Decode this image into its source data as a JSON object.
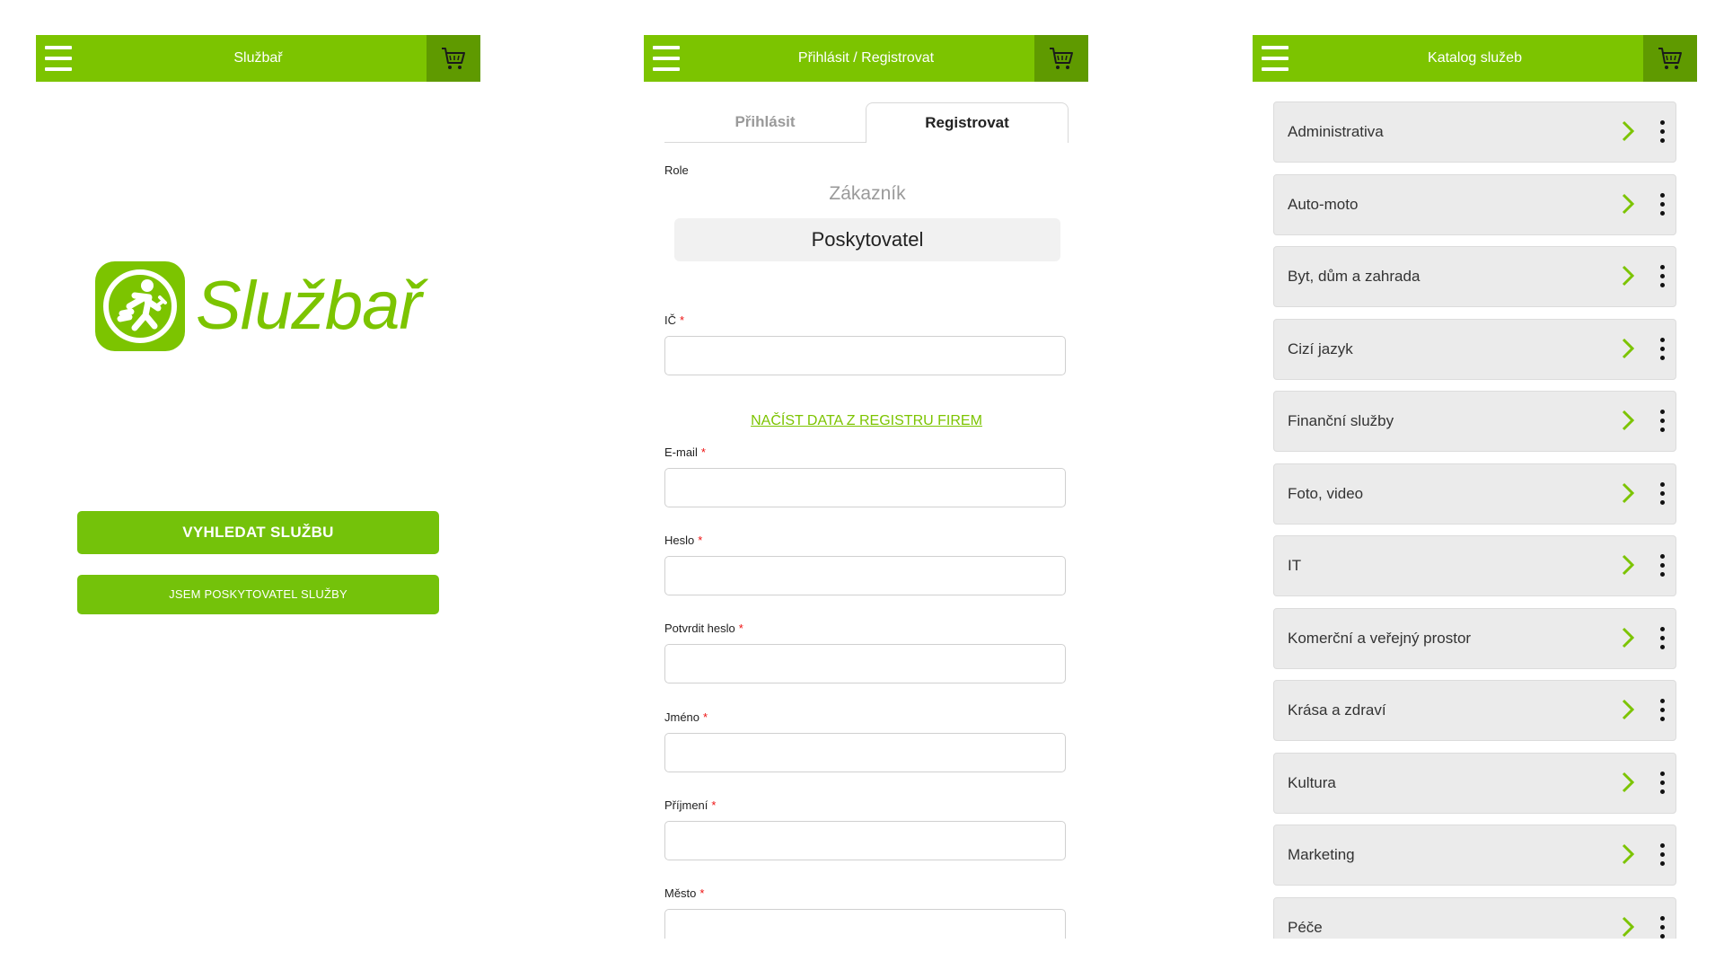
{
  "colors": {
    "accent": "#7cc400",
    "accent_dark": "#5f9a00",
    "required": "#e11111"
  },
  "screen_home": {
    "title": "Službař",
    "brand_name": "Službař",
    "search_button": "VYHLEDAT SLUŽBU",
    "provider_button": "JSEM POSKYTOVATEL SLUŽBY"
  },
  "screen_register": {
    "title": "Přihlásit / Registrovat",
    "tabs": {
      "login": "Přihlásit",
      "register": "Registrovat"
    },
    "role_label": "Role",
    "role_options": [
      "Zákazník",
      "Poskytovatel"
    ],
    "selected_role": "Poskytovatel",
    "fields": {
      "ic": {
        "label": "IČ",
        "value": ""
      },
      "email": {
        "label": "E-mail",
        "value": ""
      },
      "password": {
        "label": "Heslo",
        "value": ""
      },
      "password_confirm": {
        "label": "Potvrdit heslo",
        "value": ""
      },
      "first_name": {
        "label": "Jméno",
        "value": ""
      },
      "last_name": {
        "label": "Příjmení",
        "value": ""
      },
      "city": {
        "label": "Město",
        "value": ""
      }
    },
    "required_mark": "*",
    "load_registry_link": "NAČÍST DATA Z REGISTRU FIREM"
  },
  "screen_catalog": {
    "title": "Katalog služeb",
    "categories": [
      "Administrativa",
      "Auto-moto",
      "Byt, dům a zahrada",
      "Cizí jazyk",
      "Finanční služby",
      "Foto, video",
      "IT",
      "Komerční a veřejný prostor",
      "Krása a zdraví",
      "Kultura",
      "Marketing",
      "Péče"
    ]
  },
  "icons": {
    "menu": "hamburger-icon",
    "cart": "shopping-cart-icon",
    "logo": "running-worker-logo",
    "chevron": "chevron-right-icon",
    "more": "vertical-dots-icon"
  }
}
